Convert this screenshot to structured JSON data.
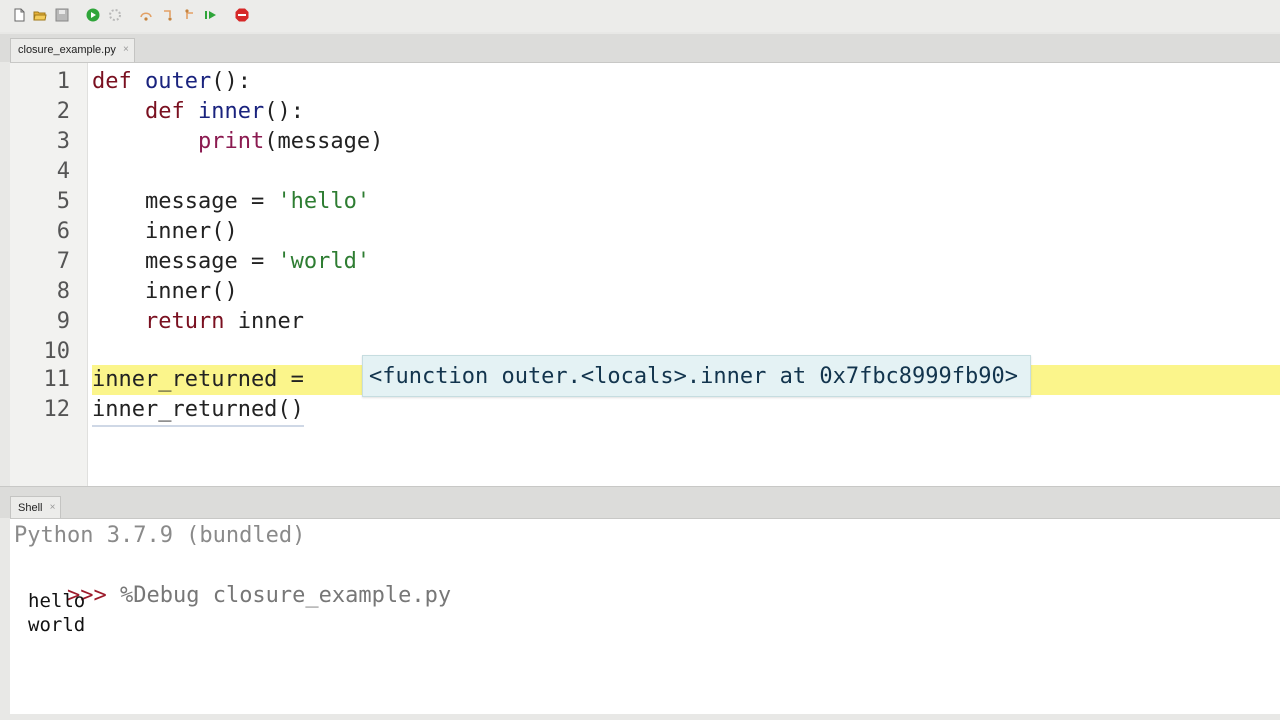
{
  "editor": {
    "tab_name": "closure_example.py",
    "lines": [
      {
        "num": "1",
        "text": "def outer():"
      },
      {
        "num": "2",
        "text": "    def inner():"
      },
      {
        "num": "3",
        "text": "        print(message)"
      },
      {
        "num": "4",
        "text": ""
      },
      {
        "num": "5",
        "text": "    message = 'hello'"
      },
      {
        "num": "6",
        "text": "    inner()"
      },
      {
        "num": "7",
        "text": "    message = 'world'"
      },
      {
        "num": "8",
        "text": "    inner()"
      },
      {
        "num": "9",
        "text": "    return inner"
      },
      {
        "num": "10",
        "text": ""
      },
      {
        "num": "11",
        "text": "inner_returned = "
      },
      {
        "num": "12",
        "text": "inner_returned()"
      }
    ],
    "tooltip": "<function outer.<locals>.inner at 0x7fbc8999fb90>",
    "highlight_color": "#fbf58b"
  },
  "shell": {
    "tab_name": "Shell",
    "banner": "Python 3.7.9 (bundled)",
    "prompt": ">>>",
    "command": "%Debug closure_example.py",
    "output": [
      "hello",
      "world"
    ]
  },
  "toolbar": {
    "icons": [
      "new-file-icon",
      "open-folder-icon",
      "save-icon",
      "run-icon",
      "debug-icon",
      "step-over-icon",
      "step-into-icon",
      "step-out-icon",
      "resume-icon",
      "stop-icon"
    ]
  }
}
